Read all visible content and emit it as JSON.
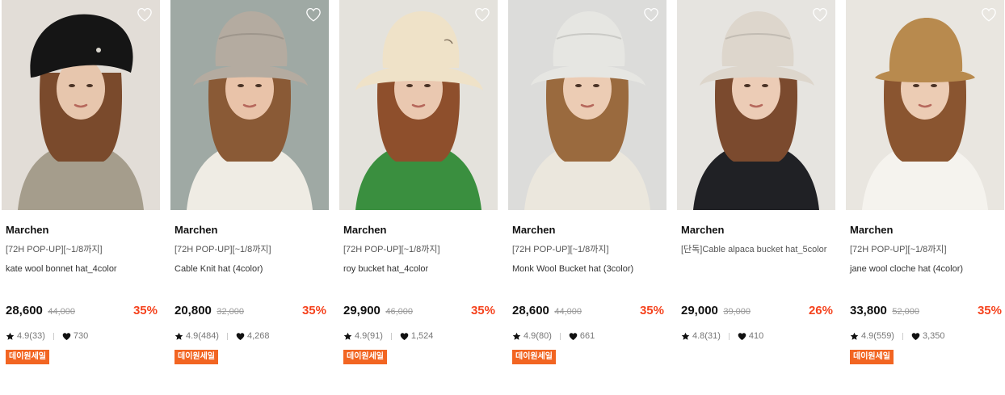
{
  "products": [
    {
      "brand": "Marchen",
      "promo": "[72H POP-UP][~1/8까지]",
      "name": "kate wool bonnet hat_4color",
      "price": "28,600",
      "original_price": "44,000",
      "discount": "35%",
      "rating": "4.9(33)",
      "likes": "730",
      "badge": "데이원세일",
      "image": {
        "bg": "#e2ddd7",
        "hat": "#151515",
        "hair": "#7a4a2c",
        "skin": "#e7c6ad",
        "top": "#a59d8c",
        "style": "bonnet"
      }
    },
    {
      "brand": "Marchen",
      "promo": "[72H POP-UP][~1/8까지]",
      "name": "Cable Knit hat (4color)",
      "price": "20,800",
      "original_price": "32,000",
      "discount": "35%",
      "rating": "4.9(484)",
      "likes": "4,268",
      "badge": "데이원세일",
      "image": {
        "bg": "#9fa9a4",
        "hat": "#b4aba0",
        "hair": "#8a5a36",
        "skin": "#e9c3a9",
        "top": "#efece4",
        "style": "bucket"
      }
    },
    {
      "brand": "Marchen",
      "promo": "[72H POP-UP][~1/8까지]",
      "name": "roy bucket hat_4color",
      "price": "29,900",
      "original_price": "46,000",
      "discount": "35%",
      "rating": "4.9(91)",
      "likes": "1,524",
      "badge": "데이원세일",
      "image": {
        "bg": "#e4e2dc",
        "hat": "#efe2c8",
        "hair": "#8e4f2c",
        "skin": "#eac8b0",
        "top": "#3a8f3f",
        "style": "fuzzy"
      }
    },
    {
      "brand": "Marchen",
      "promo": "[72H POP-UP][~1/8까지]",
      "name": "Monk Wool Bucket hat (3color)",
      "price": "28,600",
      "original_price": "44,000",
      "discount": "35%",
      "rating": "4.9(80)",
      "likes": "661",
      "badge": "데이원세일",
      "image": {
        "bg": "#dcdcda",
        "hat": "#e6e6e2",
        "hair": "#9a6a3e",
        "skin": "#ecccb4",
        "top": "#ebe7dd",
        "style": "bucket"
      }
    },
    {
      "brand": "Marchen",
      "promo": "[단독]Cable alpaca bucket hat_5color",
      "name": "",
      "price": "29,000",
      "original_price": "39,000",
      "discount": "26%",
      "rating": "4.8(31)",
      "likes": "410",
      "badge": "",
      "image": {
        "bg": "#e6e4e0",
        "hat": "#ddd6cc",
        "hair": "#7b4a2e",
        "skin": "#ecccb6",
        "top": "#202125",
        "style": "bucket"
      }
    },
    {
      "brand": "Marchen",
      "promo": "[72H POP-UP][~1/8까지]",
      "name": "jane wool cloche hat (4color)",
      "price": "33,800",
      "original_price": "52,000",
      "discount": "35%",
      "rating": "4.9(559)",
      "likes": "3,350",
      "badge": "데이원세일",
      "image": {
        "bg": "#e9e6e0",
        "hat": "#b88a4e",
        "hair": "#8a5530",
        "skin": "#ecccb4",
        "top": "#f5f3ee",
        "style": "cloche"
      }
    }
  ]
}
